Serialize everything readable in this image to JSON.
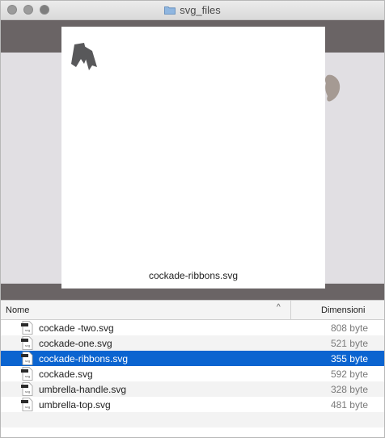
{
  "window": {
    "title": "svg_files"
  },
  "preview": {
    "caption": "cockade-ribbons.svg"
  },
  "columns": {
    "name": "Nome",
    "size": "Dimensioni"
  },
  "files": [
    {
      "name": "cockade -two.svg",
      "size": "808 byte",
      "selected": false
    },
    {
      "name": "cockade-one.svg",
      "size": "521 byte",
      "selected": false
    },
    {
      "name": "cockade-ribbons.svg",
      "size": "355 byte",
      "selected": true
    },
    {
      "name": "cockade.svg",
      "size": "592 byte",
      "selected": false
    },
    {
      "name": "umbrella-handle.svg",
      "size": "328 byte",
      "selected": false
    },
    {
      "name": "umbrella-top.svg",
      "size": "481 byte",
      "selected": false
    }
  ],
  "icons": {
    "file": "svg-file-icon",
    "folder": "folder-icon"
  },
  "colors": {
    "selection": "#0b64d0",
    "preview_bg": "#6a6465",
    "ribbon": "#58585a"
  }
}
